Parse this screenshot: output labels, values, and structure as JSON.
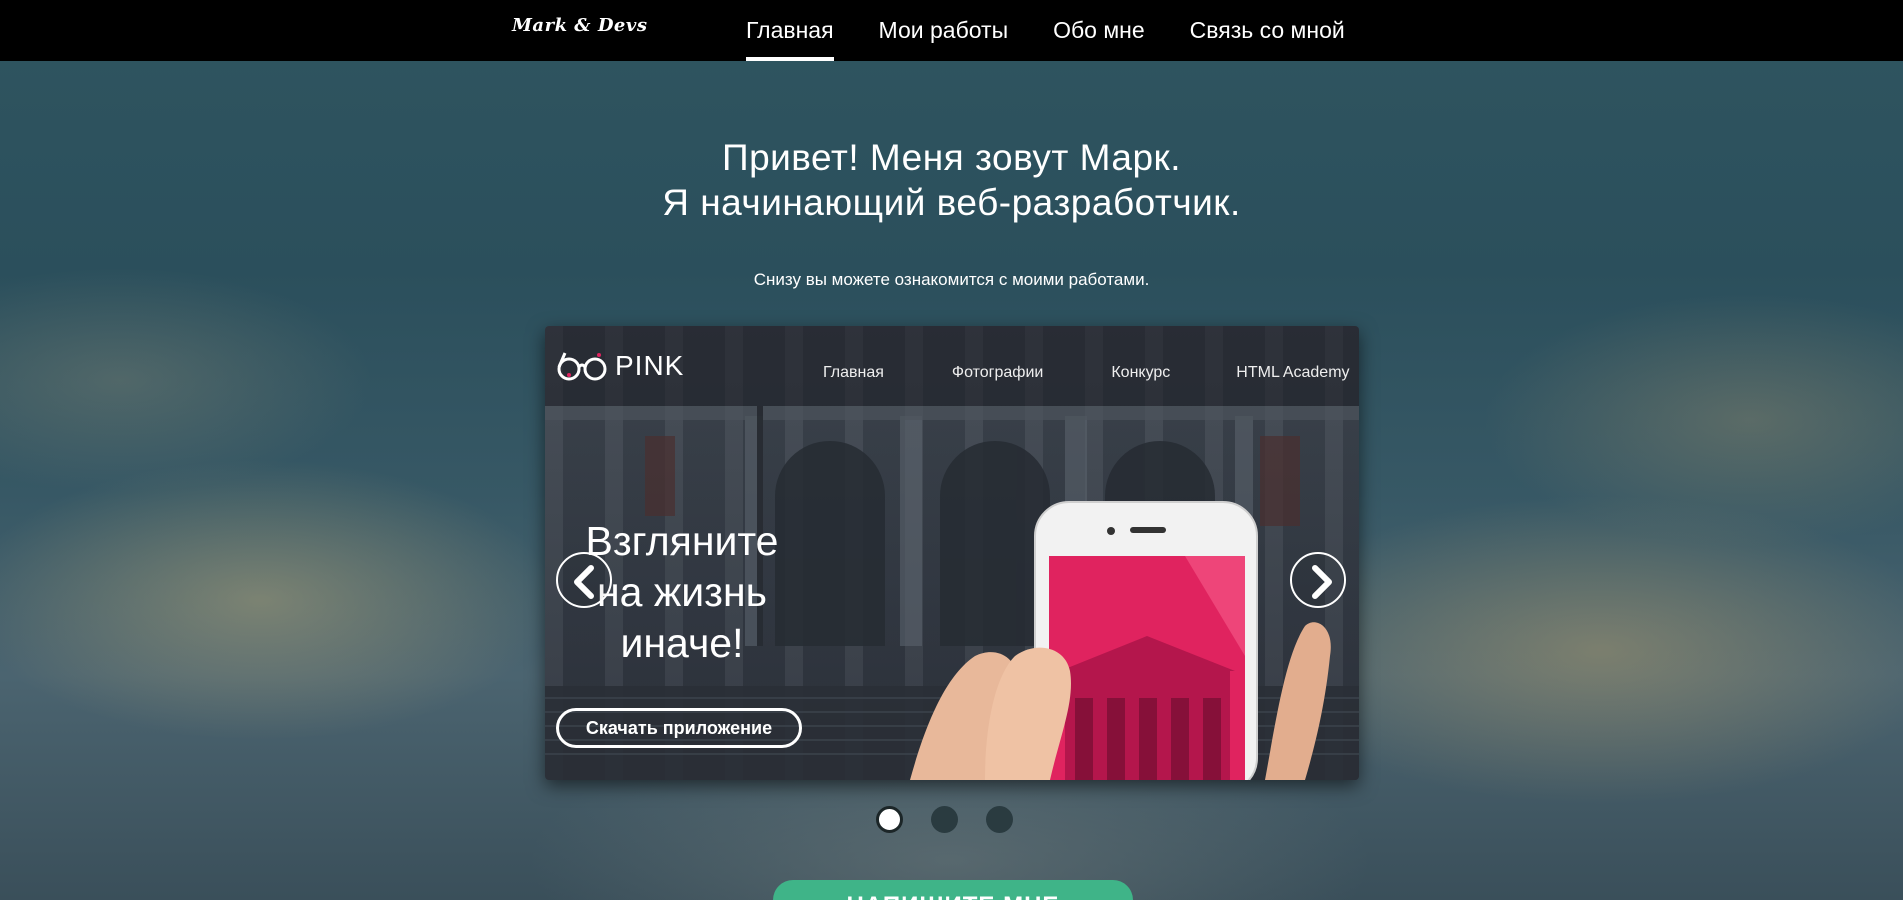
{
  "header": {
    "logo": "Mark & Devs",
    "nav": [
      {
        "label": "Главная",
        "active": true
      },
      {
        "label": "Мои работы",
        "active": false
      },
      {
        "label": "Обо мне",
        "active": false
      },
      {
        "label": "Связь со мной",
        "active": false
      }
    ]
  },
  "hero": {
    "title_line1": "Привет! Меня зовут Марк.",
    "title_line2": "Я начинающий веб-разработчик.",
    "subtitle": "Снизу вы можете ознакомится с моими работами."
  },
  "slider": {
    "current_slide": 1,
    "total_slides": 3,
    "slide": {
      "logo_text": "PINK",
      "nav": [
        "Главная",
        "Фотографии",
        "Конкурс",
        "HTML Academy"
      ],
      "heading_line1": "Взгляните",
      "heading_line2": "на жизнь",
      "heading_line3": "иначе!",
      "button_label": "Скачать приложение",
      "accent_color": "#e0235f"
    },
    "prev_icon": "chevron-left-icon",
    "next_icon": "chevron-right-icon"
  },
  "cta": {
    "label": "НАПИШИТЕ МНЕ",
    "color": "#3fb488"
  }
}
